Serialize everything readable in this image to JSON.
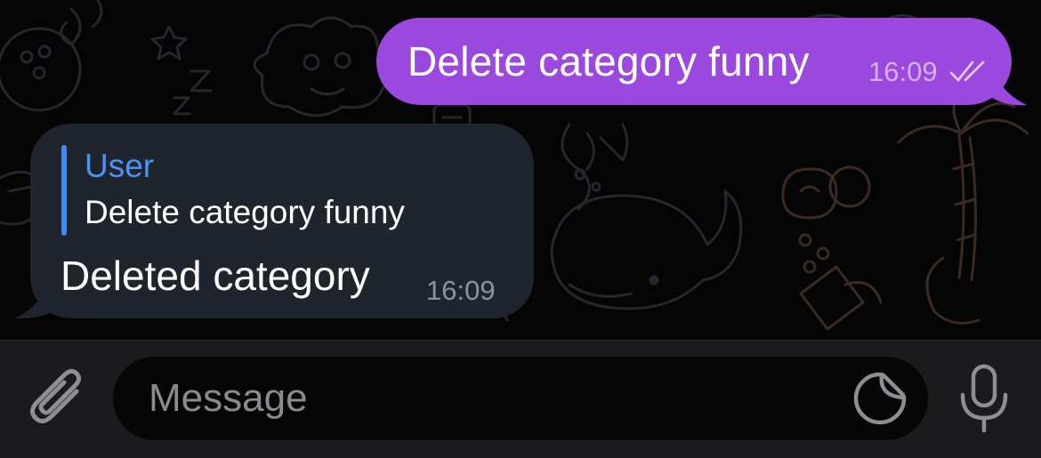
{
  "chat": {
    "outgoing": {
      "text": "Delete category funny",
      "time": "16:09",
      "status_icon": "double-check-icon"
    },
    "incoming": {
      "reply_to": {
        "name": "User",
        "text": "Delete category funny"
      },
      "text": "Deleted category",
      "time": "16:09"
    }
  },
  "input_bar": {
    "placeholder": "Message",
    "value": "",
    "icons": {
      "attach": "paperclip-icon",
      "sticker": "sticker-icon",
      "voice": "microphone-icon"
    }
  },
  "colors": {
    "outgoing_bubble": "#9b48de",
    "incoming_bubble": "#1f242d",
    "reply_accent": "#4a94f5",
    "background": "#050506",
    "input_bar": "#1b1b1d"
  }
}
